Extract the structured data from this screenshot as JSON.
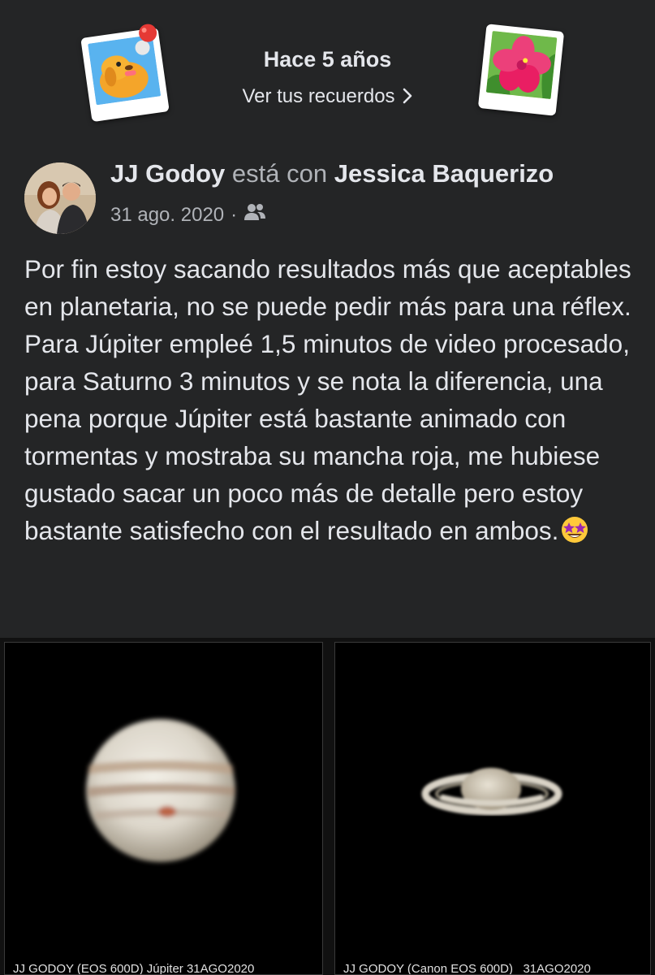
{
  "memories": {
    "title": "Hace 5 años",
    "link_label": "Ver tus recuerdos",
    "left_sticker_icon": "dog-photo-sticker",
    "right_sticker_icon": "hibiscus-photo-sticker"
  },
  "post": {
    "author": "JJ Godoy",
    "with_word": "está con",
    "tagged": "Jessica Baquerizo",
    "date": "31 ago. 2020",
    "separator": "·",
    "audience_icon": "friends-icon",
    "text": "Por fin estoy sacando resultados más que aceptables en planetaria, no se puede pedir más para una réflex. Para Júpiter empleé 1,5 minutos de video procesado, para Saturno 3 minutos y se nota la diferencia, una pena porque Júpiter está bastante animado con tormentas y mostraba su mancha roja, me hubiese gustado sacar un poco más de detalle pero estoy bastante satisfecho con el resultado en ambos.",
    "emoji": "star-struck-emoji"
  },
  "photos": [
    {
      "subject": "jupiter",
      "caption": "JJ GODOY (EOS 600D) Júpiter 31AGO2020"
    },
    {
      "subject": "saturn",
      "caption": "JJ GODOY (Canon EOS 600D)   31AGO2020"
    }
  ],
  "colors": {
    "background": "#242526",
    "primary_text": "#e4e6eb",
    "secondary_text": "#b0b3b8"
  }
}
